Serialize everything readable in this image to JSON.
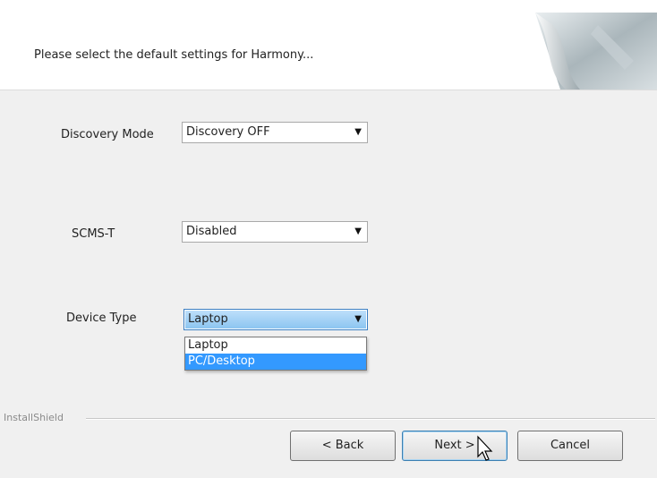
{
  "header": {
    "prompt": "Please select the default settings for Harmony..."
  },
  "fields": [
    {
      "label": "Discovery Mode",
      "value": "Discovery OFF"
    },
    {
      "label": "SCMS-T",
      "value": "Disabled"
    },
    {
      "label": "Device Type",
      "value": "Laptop"
    }
  ],
  "device_type_dropdown": {
    "options": [
      "Laptop",
      "PC/Desktop"
    ],
    "highlighted": "PC/Desktop"
  },
  "footer": {
    "brand": "InstallShield",
    "back_label": "< Back",
    "next_label": "Next >",
    "cancel_label": "Cancel"
  },
  "colors": {
    "panel": "#f0f0f0",
    "selection": "#3399ff",
    "active_select": "#8ac4f0"
  }
}
